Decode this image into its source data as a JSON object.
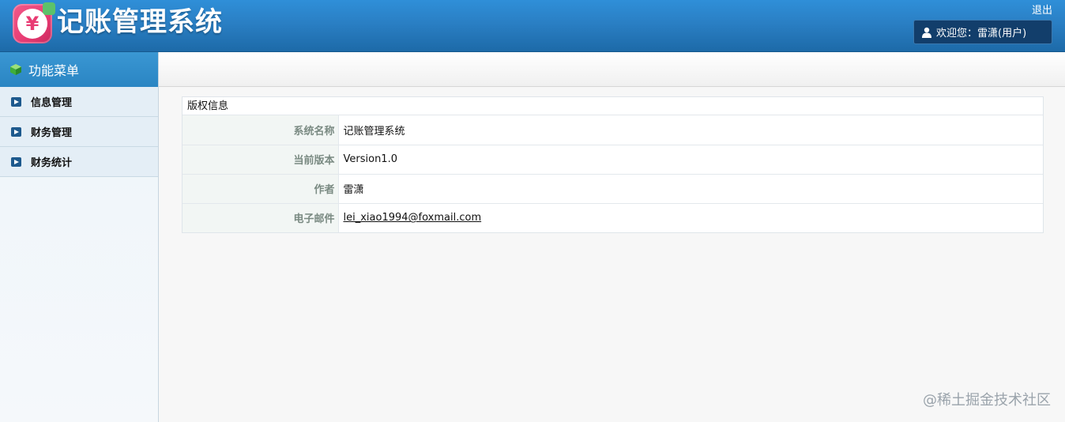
{
  "header": {
    "logo_text": "记账管理系统",
    "logo_symbol": "¥",
    "logout_label": "退出",
    "welcome_text": "欢迎您：雷潇(用户)"
  },
  "sidebar": {
    "title": "功能菜单",
    "items": [
      {
        "label": "信息管理"
      },
      {
        "label": "财务管理"
      },
      {
        "label": "财务统计"
      }
    ]
  },
  "main": {
    "panel_title": "版权信息",
    "rows": [
      {
        "label": "系统名称",
        "value": "记账管理系统"
      },
      {
        "label": "当前版本",
        "value": "Version1.0"
      },
      {
        "label": "作者",
        "value": "雷潇"
      },
      {
        "label": "电子邮件",
        "value": "lei_xiao1994@foxmail.com"
      }
    ]
  },
  "watermark": "@稀土掘金技术社区",
  "colors": {
    "header_blue": "#2a7fc4",
    "logo_pink": "#e83b73",
    "welcome_bg": "#123e6b"
  }
}
